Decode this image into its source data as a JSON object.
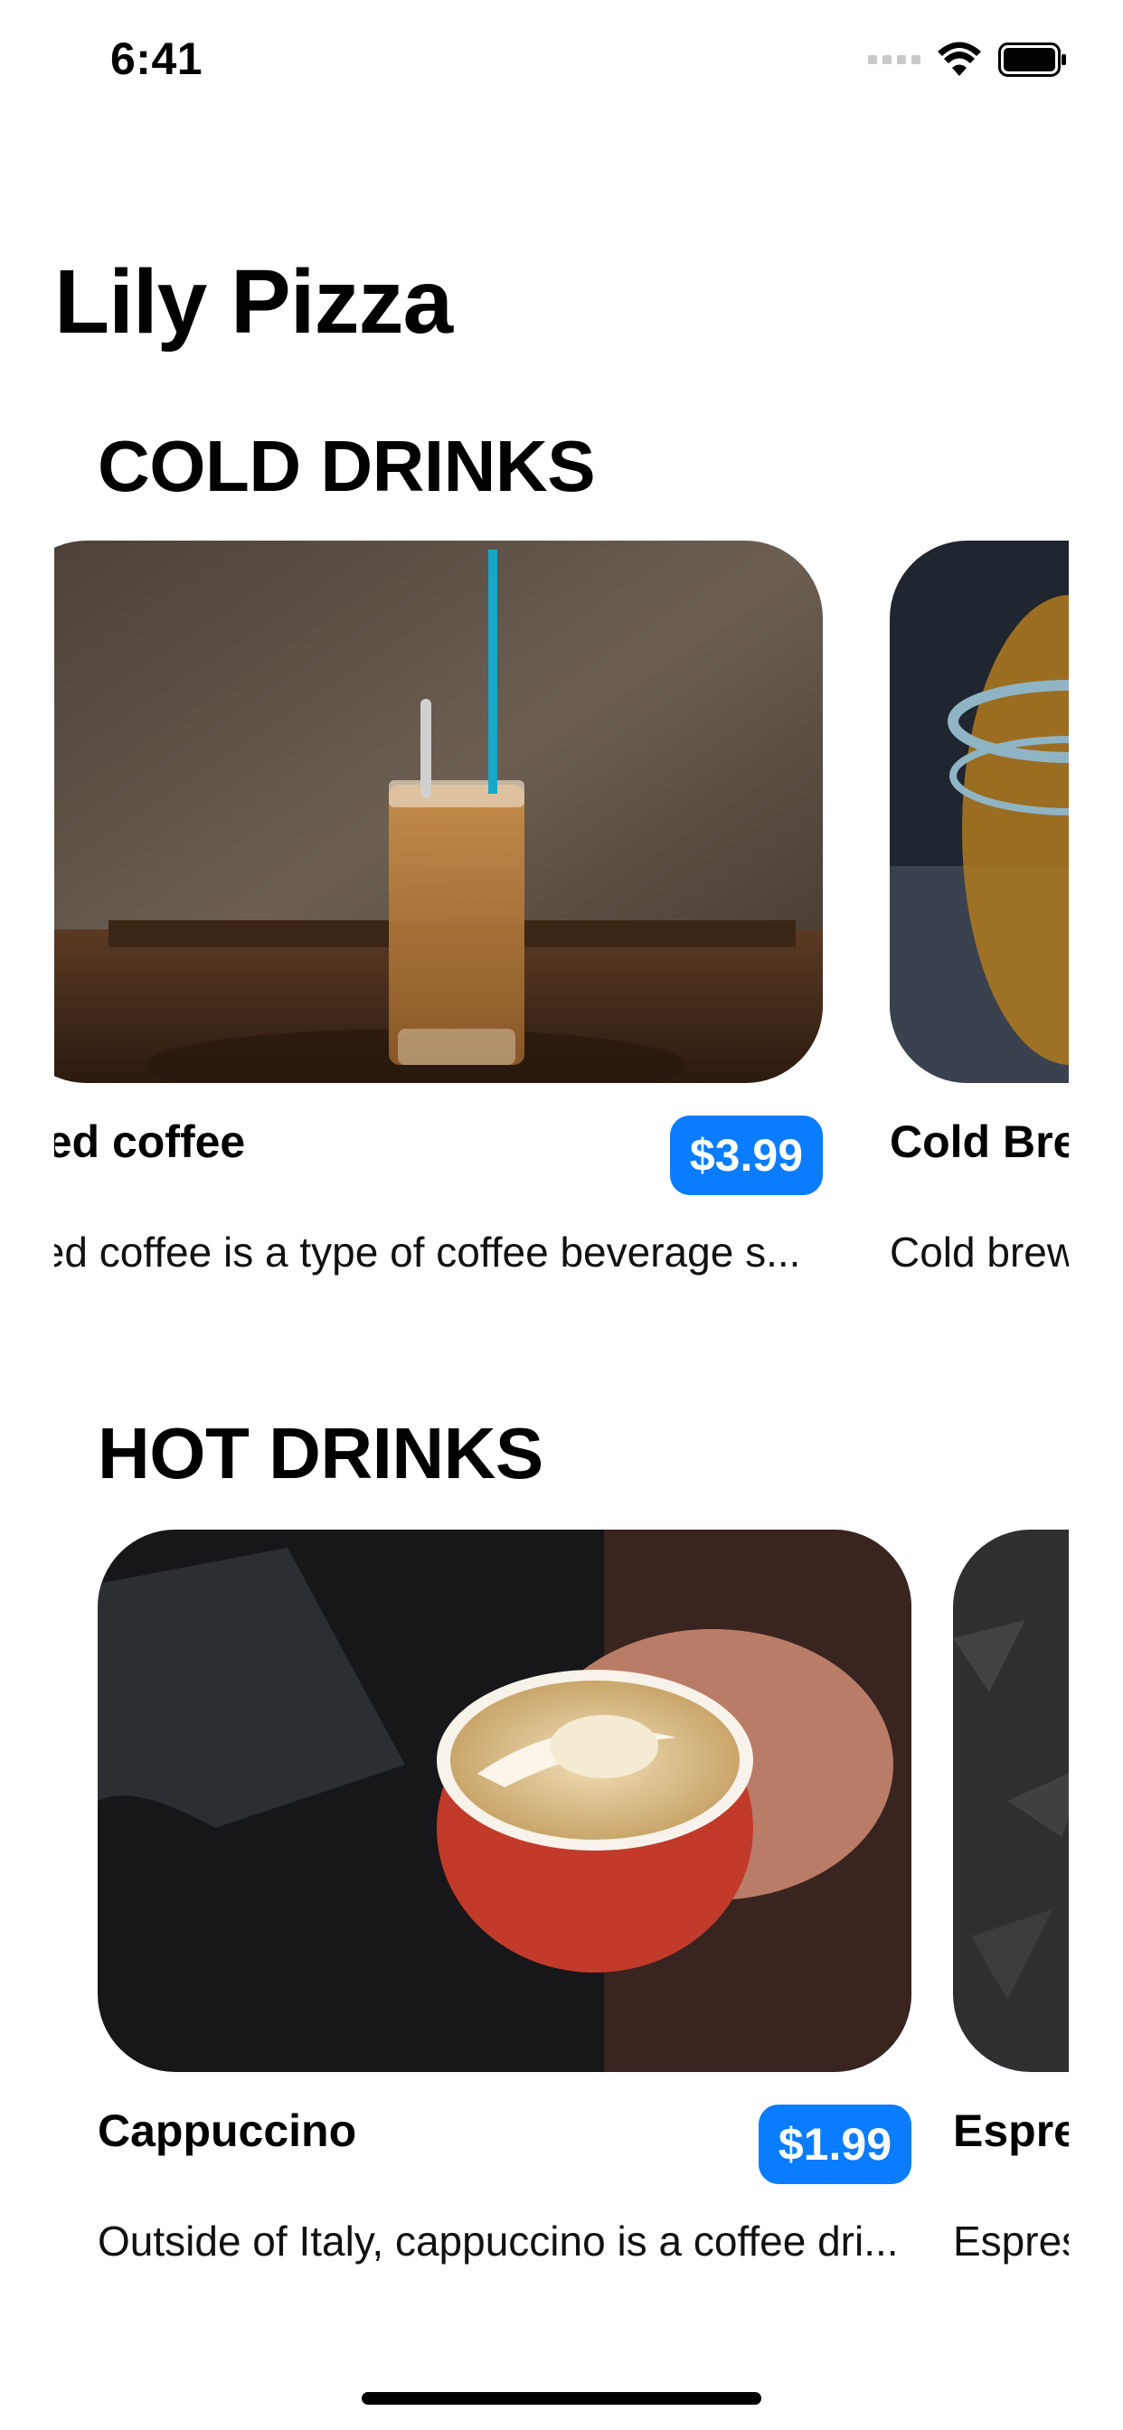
{
  "status_bar": {
    "time": "6:41"
  },
  "app": {
    "title": "Lily Pizza"
  },
  "sections": {
    "cold": {
      "title": "COLD DRINKS",
      "items": [
        {
          "name": "Iced coffee",
          "price": "$3.99",
          "description": "Iced coffee is a type of coffee beverage s..."
        },
        {
          "name": "Cold Bre",
          "price": "",
          "description": "Cold brew"
        }
      ]
    },
    "hot": {
      "title": "HOT DRINKS",
      "items": [
        {
          "name": "Cappuccino",
          "price": "$1.99",
          "description": "Outside of Italy, cappuccino is a coffee dri..."
        },
        {
          "name": "Espre",
          "price": "",
          "description": "Espres"
        }
      ]
    }
  },
  "colors": {
    "accent": "#0a7cff"
  },
  "icons": [
    "signal-icon",
    "wifi-icon",
    "battery-icon"
  ]
}
